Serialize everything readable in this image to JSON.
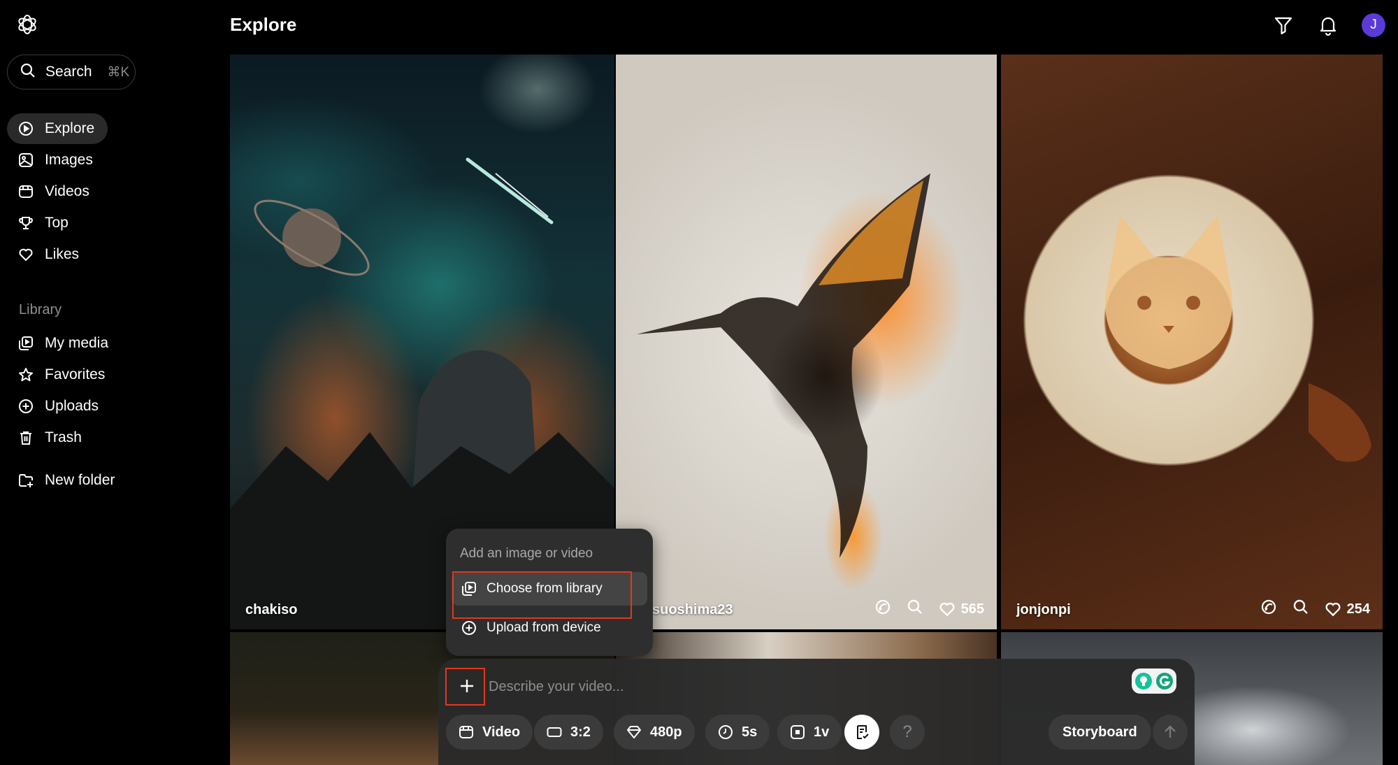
{
  "header": {
    "title": "Explore",
    "avatar_initial": "J"
  },
  "search": {
    "label": "Search",
    "shortcut": "⌘K"
  },
  "nav": [
    {
      "label": "Explore",
      "icon": "play-circle-icon",
      "active": true
    },
    {
      "label": "Images",
      "icon": "image-icon"
    },
    {
      "label": "Videos",
      "icon": "film-icon"
    },
    {
      "label": "Top",
      "icon": "trophy-icon"
    },
    {
      "label": "Likes",
      "icon": "heart-icon"
    }
  ],
  "library": {
    "label": "Library",
    "items": [
      {
        "label": "My media",
        "icon": "media-icon"
      },
      {
        "label": "Favorites",
        "icon": "star-icon"
      },
      {
        "label": "Uploads",
        "icon": "plus-circle-icon"
      },
      {
        "label": "Trash",
        "icon": "trash-icon"
      }
    ],
    "new_folder": "New folder"
  },
  "tiles": [
    {
      "author": "chakiso"
    },
    {
      "author": "suoshima23",
      "likes": "565"
    },
    {
      "author": "jonjonpi",
      "likes": "254"
    }
  ],
  "menu": {
    "heading": "Add an image or video",
    "items": [
      {
        "label": "Choose from library",
        "icon": "library-icon"
      },
      {
        "label": "Upload from device",
        "icon": "plus-circle-icon"
      }
    ]
  },
  "composer": {
    "placeholder": "Describe your video...",
    "type": "Video",
    "aspect": "3:2",
    "resolution": "480p",
    "duration": "5s",
    "variations": "1v",
    "help": "?",
    "storyboard": "Storyboard"
  },
  "colors": {
    "highlight_box": "#e2381e",
    "avatar": "#5b3bd6",
    "panel": "#2e2e2e"
  }
}
